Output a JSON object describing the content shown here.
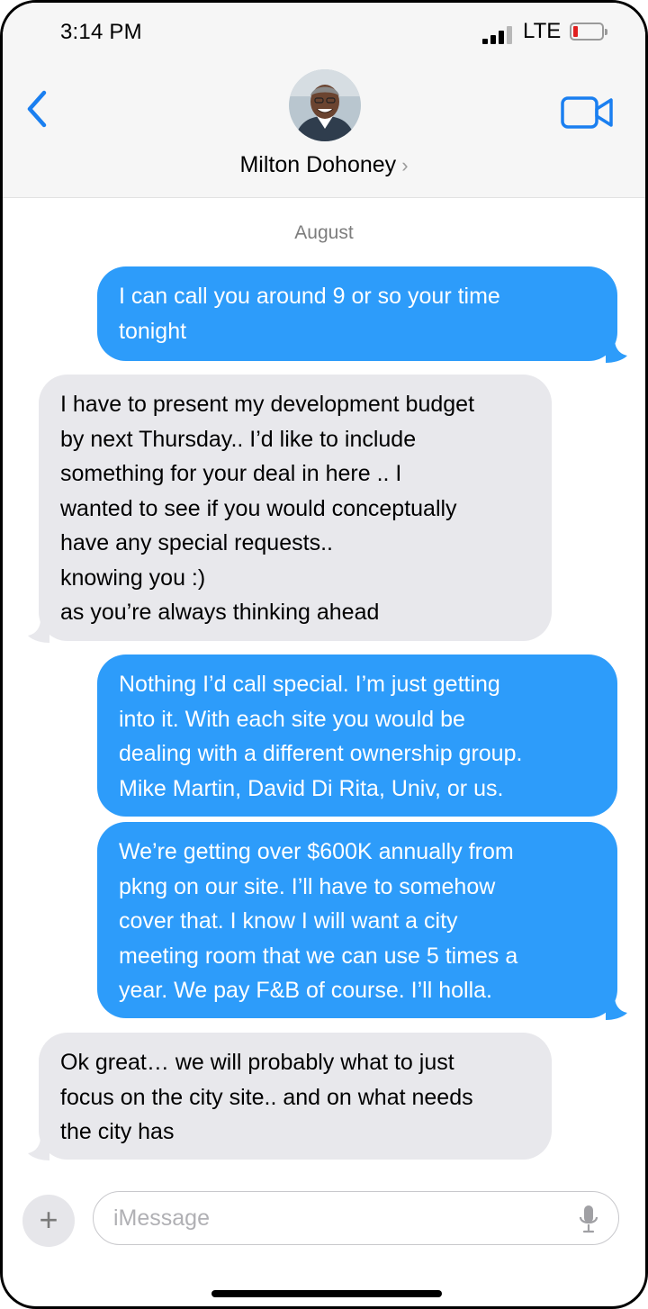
{
  "status_bar": {
    "time": "3:14 PM",
    "network": "LTE"
  },
  "header": {
    "contact_name": "Milton Dohoney",
    "contact_chevron": "›"
  },
  "thread": {
    "date_label": "August",
    "messages": [
      {
        "direction": "outgoing",
        "text": "I can call you around 9 or so your time\ntonight"
      },
      {
        "direction": "incoming",
        "text": "I have to present my development budget\nby next Thursday.. I’d like to include\nsomething for your deal in here .. I\nwanted to see if you would conceptually\nhave any special requests..\nknowing you :)\nas you’re always thinking ahead"
      },
      {
        "direction": "outgoing",
        "text": "Nothing I’d call special. I’m just getting\ninto it. With each site you would be\ndealing with a different ownership group.\nMike Martin, David Di Rita, Univ, or us."
      },
      {
        "direction": "outgoing",
        "text": "We’re getting over $600K annually from\npkng on our site. I’ll have to somehow\ncover that. I know I will want a city\nmeeting room that we can use 5 times a\nyear. We pay F&B of course. I’ll holla."
      },
      {
        "direction": "incoming",
        "text": "Ok great… we will probably what to just\nfocus on the city site.. and on what needs\nthe city has"
      }
    ]
  },
  "composer": {
    "placeholder": "iMessage",
    "plus_label": "+"
  },
  "icons": {
    "back": "chevron-left-icon",
    "video": "video-camera-icon",
    "mic": "microphone-icon",
    "signal": "cellular-signal-icon",
    "battery": "battery-low-icon"
  },
  "colors": {
    "outgoing_bubble": "#2d9cfa",
    "incoming_bubble": "#e8e8ec",
    "accent": "#1a7ff0",
    "battery_low": "#e02020"
  }
}
